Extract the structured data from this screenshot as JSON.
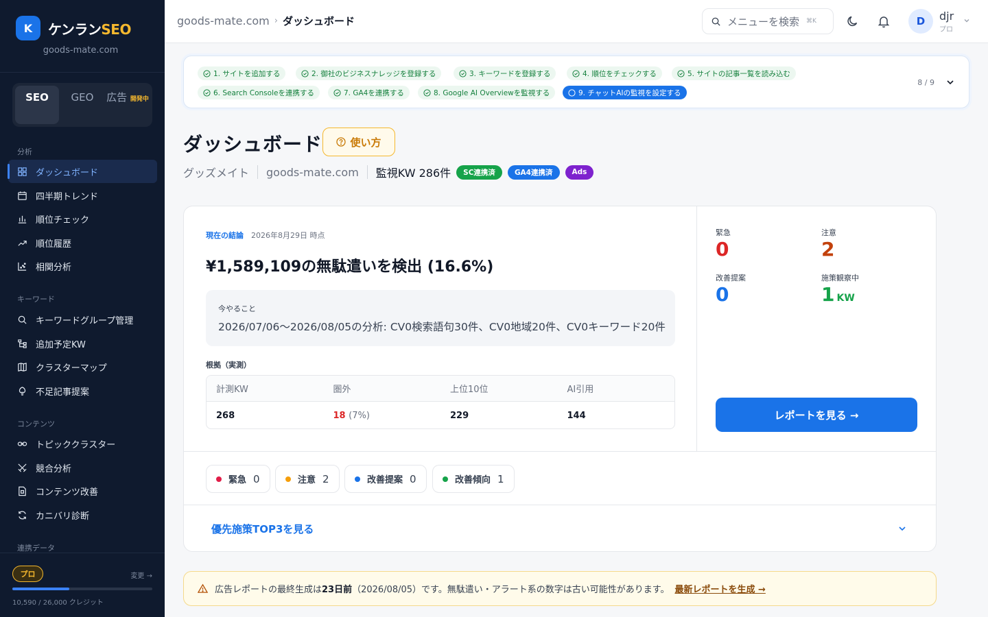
{
  "brand": {
    "logo_letter": "K",
    "name_main": "ケンラン",
    "name_accent": "SEO",
    "site": "goods-mate.com"
  },
  "modes": [
    {
      "label": "SEO",
      "active": true
    },
    {
      "label": "GEO",
      "active": false
    },
    {
      "label": "広告",
      "badge": "開発中",
      "active": false
    }
  ],
  "sidebar": {
    "sections": [
      {
        "title": "分析",
        "items": [
          {
            "label": "ダッシュボード",
            "icon": "dashboard-icon",
            "active": true
          },
          {
            "label": "四半期トレンド",
            "icon": "calendar-icon"
          },
          {
            "label": "順位チェック",
            "icon": "bar-chart-icon"
          },
          {
            "label": "順位履歴",
            "icon": "trend-icon"
          },
          {
            "label": "相関分析",
            "icon": "scatter-icon"
          }
        ]
      },
      {
        "title": "キーワード",
        "items": [
          {
            "label": "キーワードグループ管理",
            "icon": "search-icon"
          },
          {
            "label": "追加予定KW",
            "icon": "tree-icon"
          },
          {
            "label": "クラスターマップ",
            "icon": "map-icon"
          },
          {
            "label": "不足記事提案",
            "icon": "lightbulb-icon"
          }
        ]
      },
      {
        "title": "コンテンツ",
        "items": [
          {
            "label": "トピッククラスター",
            "icon": "link-icon"
          },
          {
            "label": "競合分析",
            "icon": "swords-icon"
          },
          {
            "label": "コンテンツ改善",
            "icon": "file-icon"
          },
          {
            "label": "カニバリ診断",
            "icon": "refresh-icon"
          }
        ]
      },
      {
        "title": "連携データ",
        "items": []
      }
    ],
    "footer": {
      "plan": "プロ",
      "change": "変更 →",
      "credit_text": "10,590 / 26,000 クレジット",
      "credit_used": 10590,
      "credit_total": 26000
    }
  },
  "header": {
    "breadcrumb": [
      "goods-mate.com",
      "ダッシュボード"
    ],
    "search_placeholder": "メニューを検索",
    "search_kbd": "⌘K",
    "user": {
      "initial": "D",
      "name": "djr",
      "plan": "プロ"
    }
  },
  "steps": {
    "items": [
      {
        "label": "1. サイトを追加する",
        "done": true
      },
      {
        "label": "2. 御社のビジネスナレッジを登録する",
        "done": true
      },
      {
        "label": "3. キーワードを登録する",
        "done": true
      },
      {
        "label": "4. 順位をチェックする",
        "done": true
      },
      {
        "label": "5. サイトの記事一覧を読み込む",
        "done": true
      },
      {
        "label": "6. Search Consoleを連携する",
        "done": true
      },
      {
        "label": "7. GA4を連携する",
        "done": true
      },
      {
        "label": "8. Google AI Overviewを監視する",
        "done": true
      },
      {
        "label": "9. チャットAIの監視を設定する",
        "done": false
      }
    ],
    "count": "8 / 9"
  },
  "page": {
    "title": "ダッシュボード",
    "howto": "使い方",
    "company": "グッズメイト",
    "site": "goods-mate.com",
    "kw_count": "監視KW 286件",
    "tags": [
      {
        "label": "SC連携済",
        "color": "#16a34a"
      },
      {
        "label": "GA4連携済",
        "color": "#1a73e8"
      },
      {
        "label": "Ads",
        "color": "#7e22ce"
      }
    ]
  },
  "conclusion": {
    "label": "現在の結論",
    "date": "2026年8月29日 時点",
    "headline": "¥1,589,109の無駄遣いを検出 (16.6%)",
    "todo_label": "今やること",
    "todo_text": "2026/07/06〜2026/08/05の分析: CV0検索語句30件、CV0地域20件、CV0キーワード20件",
    "basis_label": "根拠（実測）",
    "table": {
      "headers": [
        "計測KW",
        "圏外",
        "上位10位",
        "AI引用"
      ],
      "values": [
        "268",
        "18",
        "229",
        "144"
      ],
      "out_pct": "(7%)"
    }
  },
  "stats": [
    {
      "label": "緊急",
      "value": "0",
      "color": "#dc2626"
    },
    {
      "label": "注意",
      "value": "2",
      "color": "#c2410c"
    },
    {
      "label": "改善提案",
      "value": "0",
      "color": "#1a73e8"
    },
    {
      "label": "施策観察中",
      "value": "1",
      "unit": "KW",
      "color": "#16a34a"
    }
  ],
  "report_button": "レポートを見る →",
  "chips": [
    {
      "label": "緊急",
      "count": "0",
      "color": "#e11d48"
    },
    {
      "label": "注意",
      "count": "2",
      "color": "#f59e0b"
    },
    {
      "label": "改善提案",
      "count": "0",
      "color": "#1a73e8"
    },
    {
      "label": "改善傾向",
      "count": "1",
      "color": "#16a34a"
    }
  ],
  "top3_link": "優先施策TOP3を見る",
  "alert": {
    "prefix": "広告レポートの最終生成は",
    "days": "23日前",
    "suffix": "（2026/08/05）です。無駄遣い・アラート系の数字は古い可能性があります。",
    "link": "最新レポートを生成 →"
  }
}
